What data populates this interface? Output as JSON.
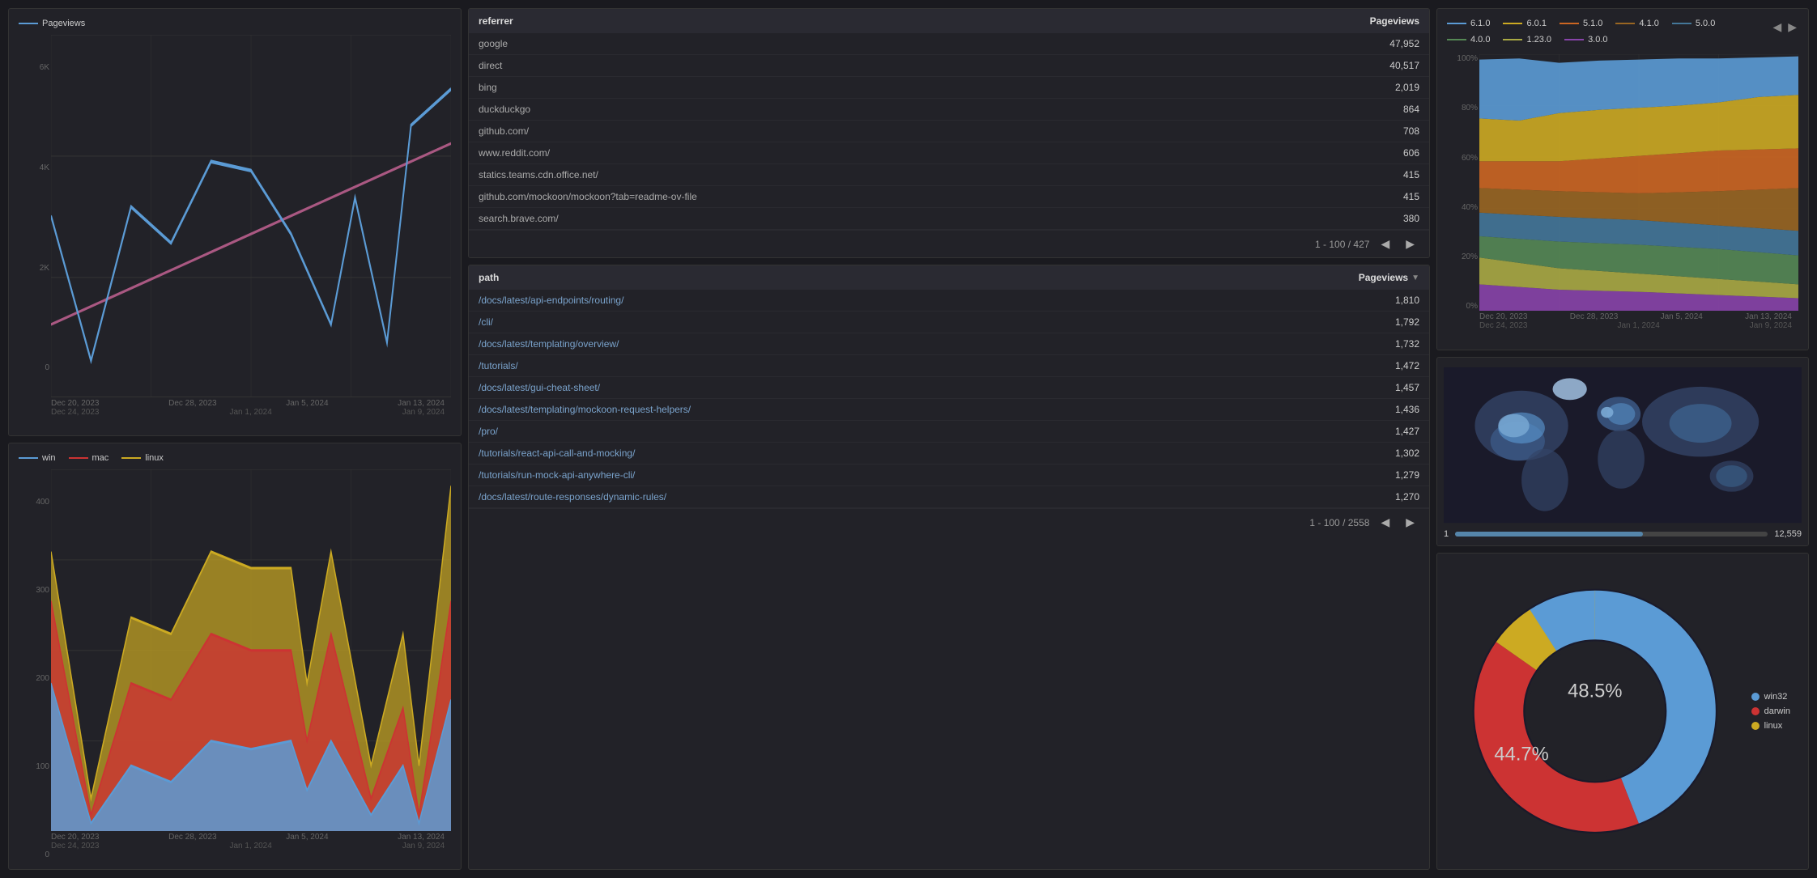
{
  "charts": {
    "pageviews": {
      "legend": [
        {
          "label": "Pageviews",
          "color": "#5b9bd5"
        }
      ],
      "y_labels": [
        "6K",
        "4K",
        "2K",
        "0"
      ],
      "x_labels_top": [
        "Dec 20, 2023",
        "Dec 28, 2023",
        "Jan 5, 2024",
        "Jan 13, 2024"
      ],
      "x_labels_bot": [
        "Dec 24, 2023",
        "Jan 1, 2024",
        "Jan 9, 2024"
      ]
    },
    "os": {
      "legend": [
        {
          "label": "win",
          "color": "#5b9bd5"
        },
        {
          "label": "mac",
          "color": "#cc3333"
        },
        {
          "label": "linux",
          "color": "#ccaa22"
        }
      ],
      "y_labels": [
        "400",
        "300",
        "200",
        "100",
        "0"
      ],
      "x_labels_top": [
        "Dec 20, 2023",
        "Dec 28, 2023",
        "Jan 5, 2024",
        "Jan 13, 2024"
      ],
      "x_labels_bot": [
        "Dec 24, 2023",
        "Jan 1, 2024",
        "Jan 9, 2024"
      ]
    },
    "versions": {
      "legend": [
        {
          "label": "6.1.0",
          "color": "#5b9bd5"
        },
        {
          "label": "6.0.1",
          "color": "#ccaa22"
        },
        {
          "label": "5.1.0",
          "color": "#cc6622"
        },
        {
          "label": "4.1.0",
          "color": "#996622"
        },
        {
          "label": "5.0.0",
          "color": "#447799"
        },
        {
          "label": "4.0.0",
          "color": "#558855"
        },
        {
          "label": "1.23.0",
          "color": "#aaaa44"
        },
        {
          "label": "3.0.0",
          "color": "#8844aa"
        }
      ],
      "y_labels": [
        "100%",
        "80%",
        "60%",
        "40%",
        "20%",
        "0%"
      ],
      "x_labels_top": [
        "Dec 20, 2023",
        "Dec 28, 2023",
        "Jan 5, 2024",
        "Jan 13, 2024"
      ],
      "x_labels_bot": [
        "Dec 24, 2023",
        "Jan 1, 2024",
        "Jan 9, 2024"
      ]
    }
  },
  "referrer_table": {
    "col1": "referrer",
    "col2": "Pageviews",
    "rows": [
      {
        "referrer": "google",
        "pageviews": "47,952"
      },
      {
        "referrer": "direct",
        "pageviews": "40,517"
      },
      {
        "referrer": "bing",
        "pageviews": "2,019"
      },
      {
        "referrer": "duckduckgo",
        "pageviews": "864"
      },
      {
        "referrer": "github.com/",
        "pageviews": "708"
      },
      {
        "referrer": "www.reddit.com/",
        "pageviews": "606"
      },
      {
        "referrer": "statics.teams.cdn.office.net/",
        "pageviews": "415"
      },
      {
        "referrer": "github.com/mockoon/mockoon?tab=readme-ov-file",
        "pageviews": "415"
      },
      {
        "referrer": "search.brave.com/",
        "pageviews": "380"
      }
    ],
    "pagination": "1 - 100 / 427"
  },
  "path_table": {
    "col1": "path",
    "col2": "Pageviews",
    "rows": [
      {
        "path": "/docs/latest/api-endpoints/routing/",
        "pageviews": "1,810"
      },
      {
        "path": "/cli/",
        "pageviews": "1,792"
      },
      {
        "path": "/docs/latest/templating/overview/",
        "pageviews": "1,732"
      },
      {
        "path": "/tutorials/",
        "pageviews": "1,472"
      },
      {
        "path": "/docs/latest/gui-cheat-sheet/",
        "pageviews": "1,457"
      },
      {
        "path": "/docs/latest/templating/mockoon-request-helpers/",
        "pageviews": "1,436"
      },
      {
        "path": "/pro/",
        "pageviews": "1,427"
      },
      {
        "path": "/tutorials/react-api-call-and-mocking/",
        "pageviews": "1,302"
      },
      {
        "path": "/tutorials/run-mock-api-anywhere-cli/",
        "pageviews": "1,279"
      },
      {
        "path": "/docs/latest/route-responses/dynamic-rules/",
        "pageviews": "1,270"
      }
    ],
    "pagination": "1 - 100 / 2558"
  },
  "map": {
    "slider_min": "1",
    "slider_max": "12,559"
  },
  "donut": {
    "segments": [
      {
        "label": "win32",
        "color": "#5b9bd5",
        "value": 48.5,
        "pct": "48.5%"
      },
      {
        "label": "darwin",
        "color": "#cc3333",
        "value": 44.7,
        "pct": "44.7%"
      },
      {
        "label": "linux",
        "color": "#ccaa22",
        "value": 6.8
      }
    ]
  }
}
